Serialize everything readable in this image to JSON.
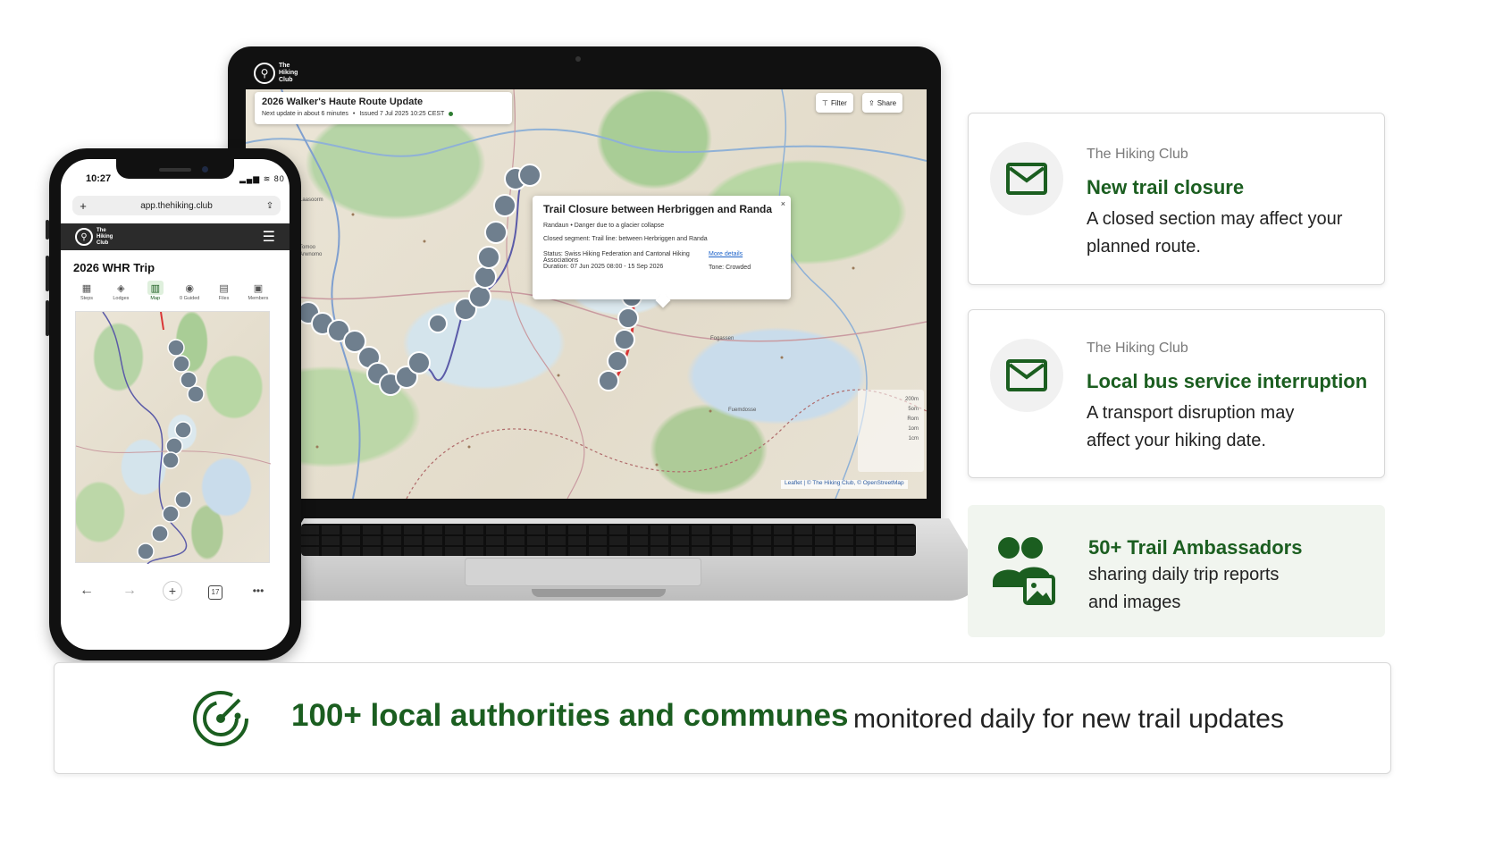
{
  "laptop": {
    "brand_logo_text": "The\nHiking\nClub",
    "header_title": "2026 Walker's Haute Route Update",
    "header_next_update": "Next update in about 6 minutes",
    "header_bullet": "•",
    "header_issued": "Issued 7 Jul 2025 10:25 CEST",
    "filter_label": "Filter",
    "share_label": "Share",
    "popup": {
      "title": "Trail Closure between Herbriggen and Randa",
      "close": "×",
      "subtitle": "Randaun • Danger due to a glacier collapse",
      "closed_segment": "Closed segment: Trail line: between Herbriggen and Randa",
      "status": "Status: Swiss Hiking Federation and Cantonal Hiking Associations",
      "duration": "Duration: 07 Jun 2025 08:00 - 15 Sep 2026",
      "more_details": "More details",
      "tone": "Tone: Crowded"
    },
    "attribution": "Leaflet | © The Hiking Club, © OpenStreetMap",
    "map_labels": [
      "Laasoorm",
      "Tomoo",
      "Arwnomo",
      "Fogassen",
      "Fuemdosse"
    ],
    "scale_labels": [
      "200m",
      "5om",
      "Rom",
      "1om",
      "1cm"
    ]
  },
  "phone": {
    "time": "10:27",
    "status_icons": "▂▄▆ ≋ 80",
    "url": "app.thehiking.club",
    "url_left_icon": "+",
    "url_right_icon": "⇪",
    "brand_logo_text": "The\nHiking\nClub",
    "trip_title": "2026 WHR Trip",
    "tabs": [
      {
        "label": "Steps",
        "icon": "▦"
      },
      {
        "label": "Lodges",
        "icon": "◈"
      },
      {
        "label": "Map",
        "icon": "▥"
      },
      {
        "label": "0 Guided",
        "icon": "◉"
      },
      {
        "label": "Files",
        "icon": "▤"
      },
      {
        "label": "Members",
        "icon": "▣"
      }
    ],
    "active_tab": "Map",
    "bottom_bar": {
      "back": "←",
      "forward": "→",
      "plus": "+",
      "tabs_count": "17",
      "more": "•••"
    }
  },
  "cards": [
    {
      "brand": "The Hiking Club",
      "title": "New trail closure",
      "body": "A closed section may affect your planned route.",
      "icon": "envelope-icon"
    },
    {
      "brand": "The Hiking Club",
      "title": "Local bus service interruption",
      "body": "A transport disruption may affect your hiking date.",
      "icon": "envelope-icon"
    }
  ],
  "ambassadors": {
    "title": "50+ Trail Ambassadors",
    "line1": "sharing daily trip reports",
    "line2": "and images",
    "icon": "people-photo-icon"
  },
  "banner": {
    "strong": "100+ local authorities and communes",
    "rest": "monitored  daily for new trail updates",
    "icon": "radar-icon"
  },
  "colors": {
    "brand_green": "#1b5e20",
    "accent_light": "#f1f5ef"
  }
}
